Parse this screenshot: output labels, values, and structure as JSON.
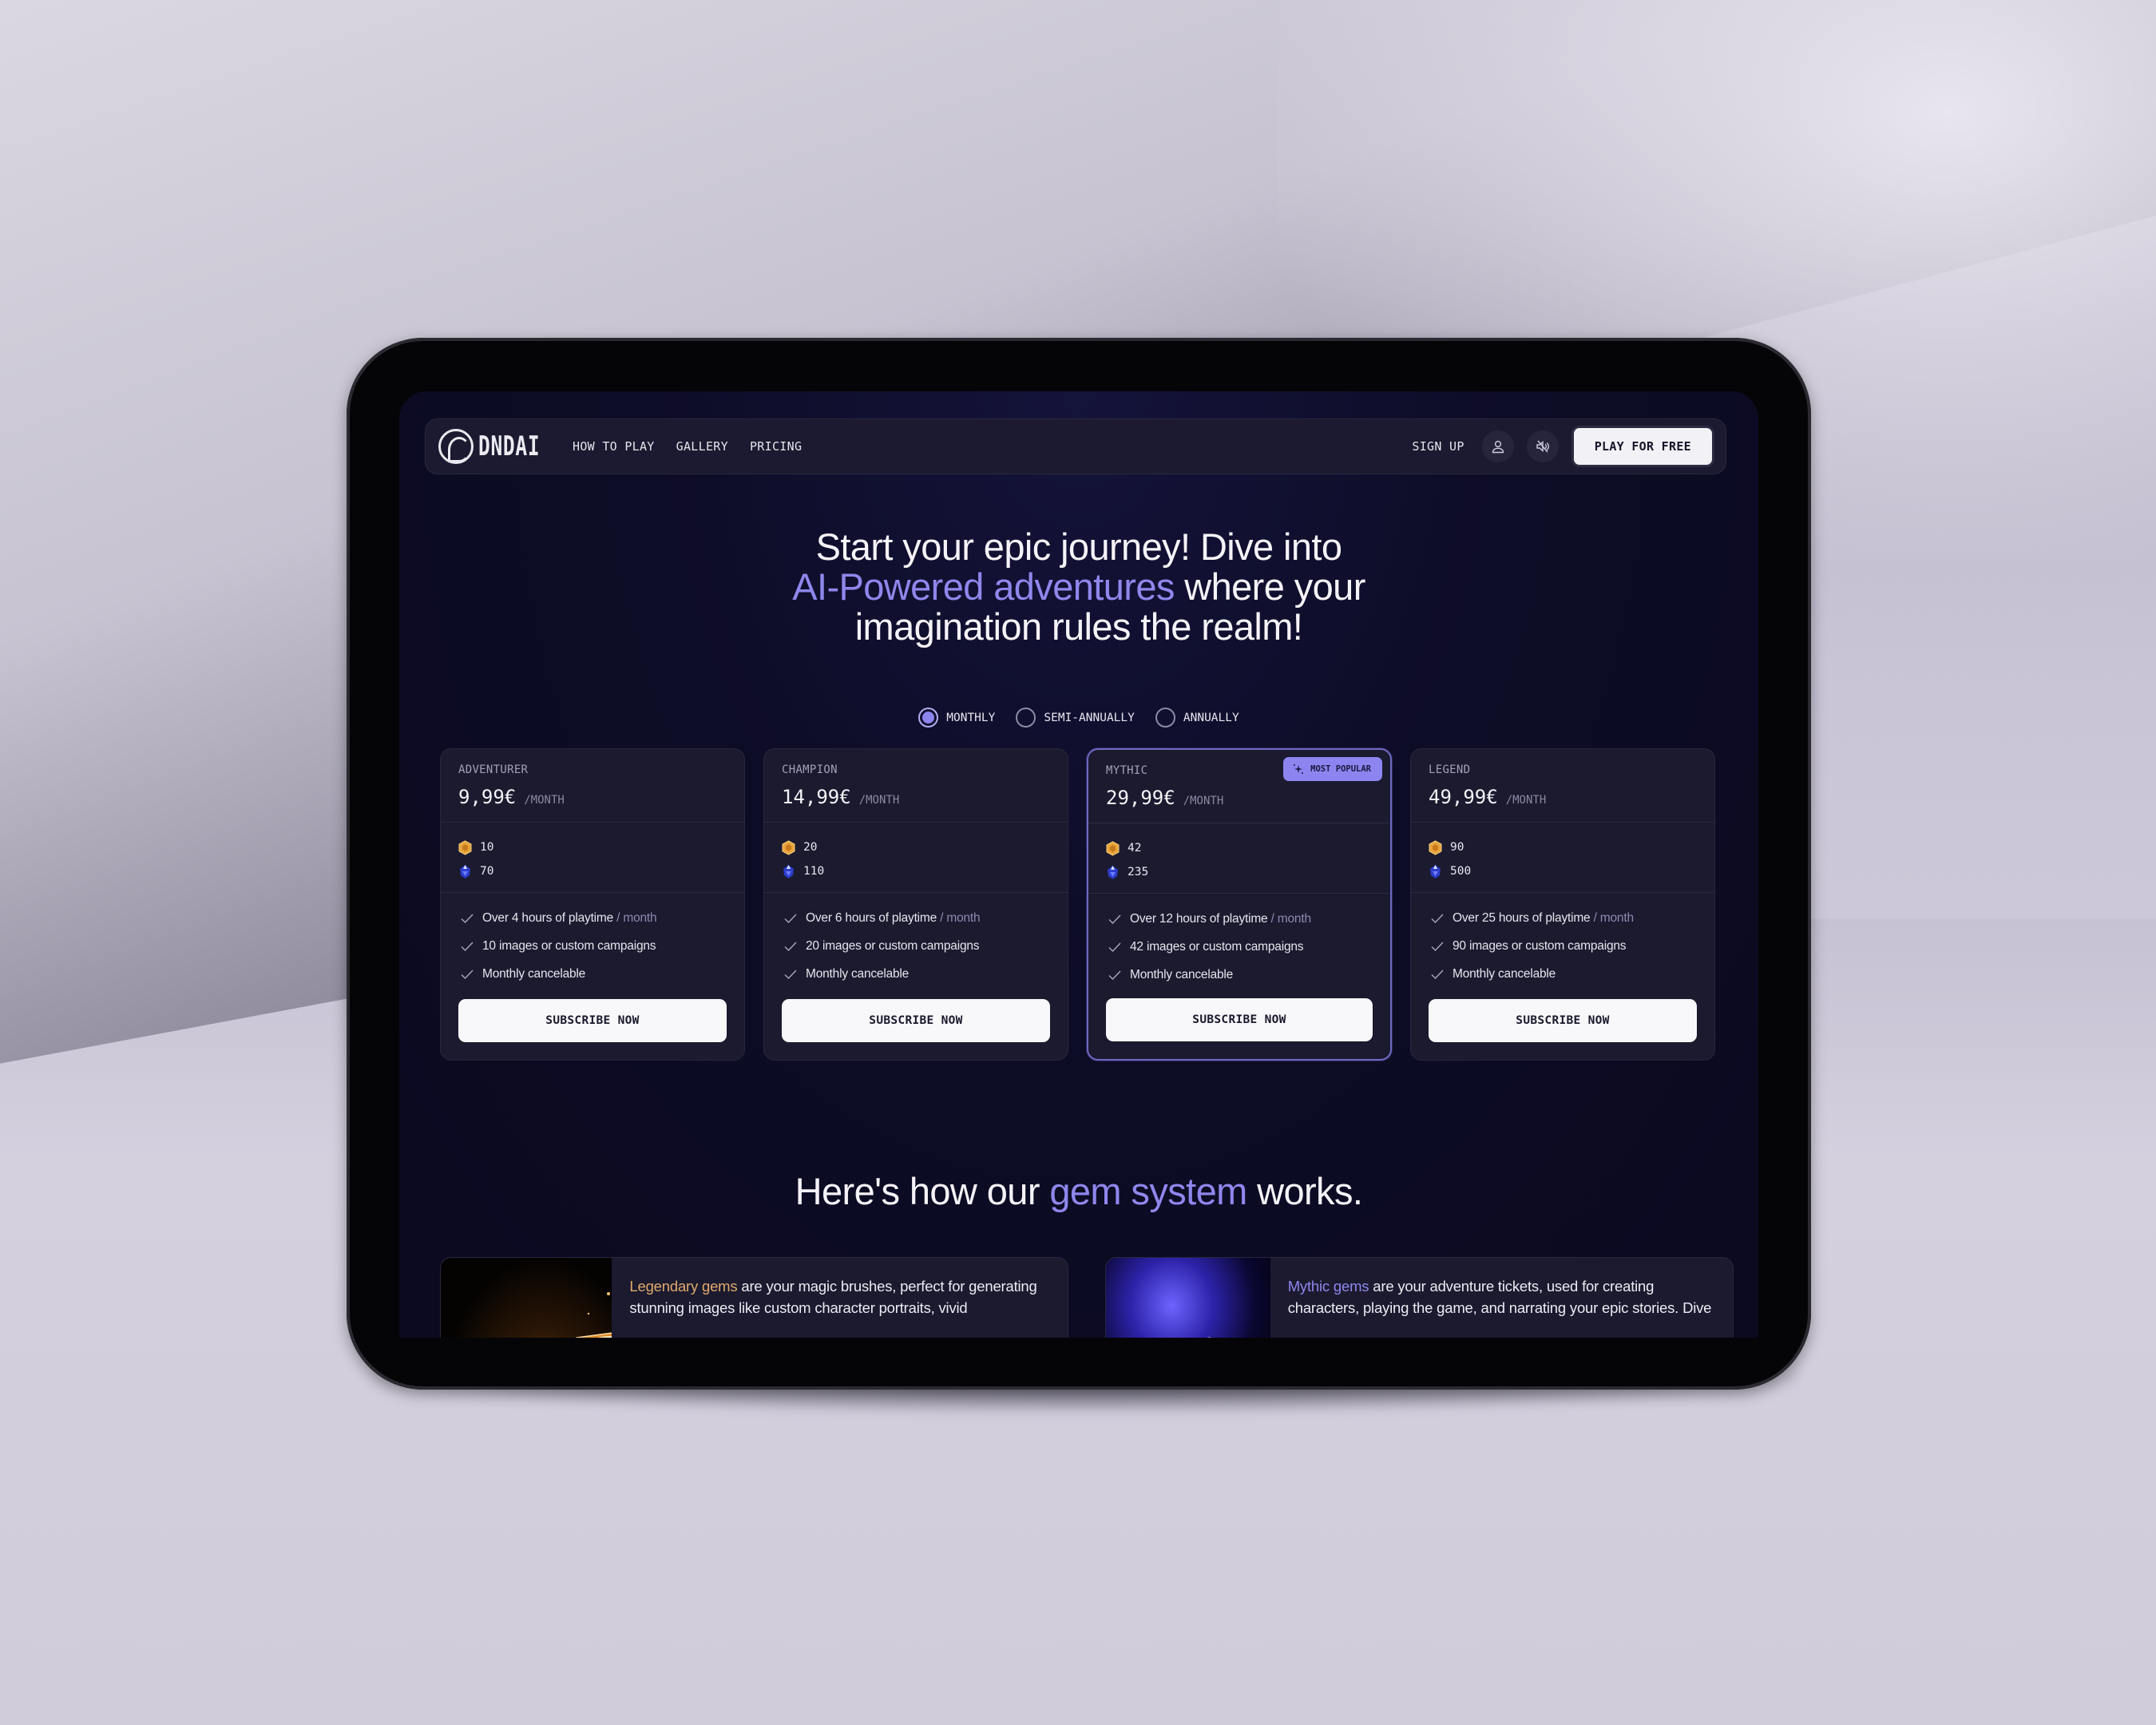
{
  "nav": {
    "logo_text": "DNDAI",
    "links": [
      "HOW TO PLAY",
      "GALLERY",
      "PRICING"
    ],
    "sign_up": "SIGN UP",
    "account_icon": "user-icon",
    "sound_icon": "speaker-muted-icon",
    "cta": "PLAY FOR FREE"
  },
  "hero": {
    "line1": "Start your epic journey! Dive into",
    "line2_accent": "AI-Powered adventures",
    "line2_rest": " where your",
    "line3": "imagination rules the realm!"
  },
  "billing": {
    "options": [
      "MONTHLY",
      "SEMI-ANNUALLY",
      "ANNUALLY"
    ],
    "selected": "MONTHLY"
  },
  "plans": [
    {
      "tier": "ADVENTURER",
      "price": "9,99€",
      "period": "/MONTH",
      "legendary_gems": "10",
      "mythic_gems": "70",
      "features": [
        {
          "text": "Over 4 hours of playtime",
          "suffix": " / month"
        },
        {
          "text": "10 images or custom campaigns",
          "suffix": ""
        },
        {
          "text": "Monthly cancelable",
          "suffix": ""
        }
      ],
      "button": "SUBSCRIBE NOW"
    },
    {
      "tier": "CHAMPION",
      "price": "14,99€",
      "period": "/MONTH",
      "legendary_gems": "20",
      "mythic_gems": "110",
      "features": [
        {
          "text": "Over 6 hours of playtime",
          "suffix": " / month"
        },
        {
          "text": "20 images or custom campaigns",
          "suffix": ""
        },
        {
          "text": "Monthly cancelable",
          "suffix": ""
        }
      ],
      "button": "SUBSCRIBE NOW"
    },
    {
      "tier": "MYTHIC",
      "price": "29,99€",
      "period": "/MONTH",
      "badge": "MOST POPULAR",
      "legendary_gems": "42",
      "mythic_gems": "235",
      "features": [
        {
          "text": "Over 12 hours of playtime",
          "suffix": " / month"
        },
        {
          "text": "42 images or custom campaigns",
          "suffix": ""
        },
        {
          "text": "Monthly cancelable",
          "suffix": ""
        }
      ],
      "button": "SUBSCRIBE NOW"
    },
    {
      "tier": "LEGEND",
      "price": "49,99€",
      "period": "/MONTH",
      "legendary_gems": "90",
      "mythic_gems": "500",
      "features": [
        {
          "text": "Over 25 hours of playtime",
          "suffix": " / month"
        },
        {
          "text": "90 images or custom campaigns",
          "suffix": ""
        },
        {
          "text": "Monthly cancelable",
          "suffix": ""
        }
      ],
      "button": "SUBSCRIBE NOW"
    }
  ],
  "gem_section": {
    "title_pre": "Here's how our ",
    "title_accent": "gem system",
    "title_post": " works.",
    "cards": [
      {
        "accent": "Legendary gems",
        "text": " are your magic brushes, perfect for generating stunning images like custom character portraits, vivid",
        "image": "golden-gems-image"
      },
      {
        "accent": "Mythic gems",
        "text": " are your adventure tickets, used for creating characters, playing the game, and narrating your epic stories. Dive",
        "image": "purple-gems-image"
      }
    ]
  },
  "colors": {
    "accent": "#8c85f0",
    "gold_accent": "#e0a96c",
    "page_bg": "#0d0c26",
    "card_bg": "#1b1a2f"
  }
}
